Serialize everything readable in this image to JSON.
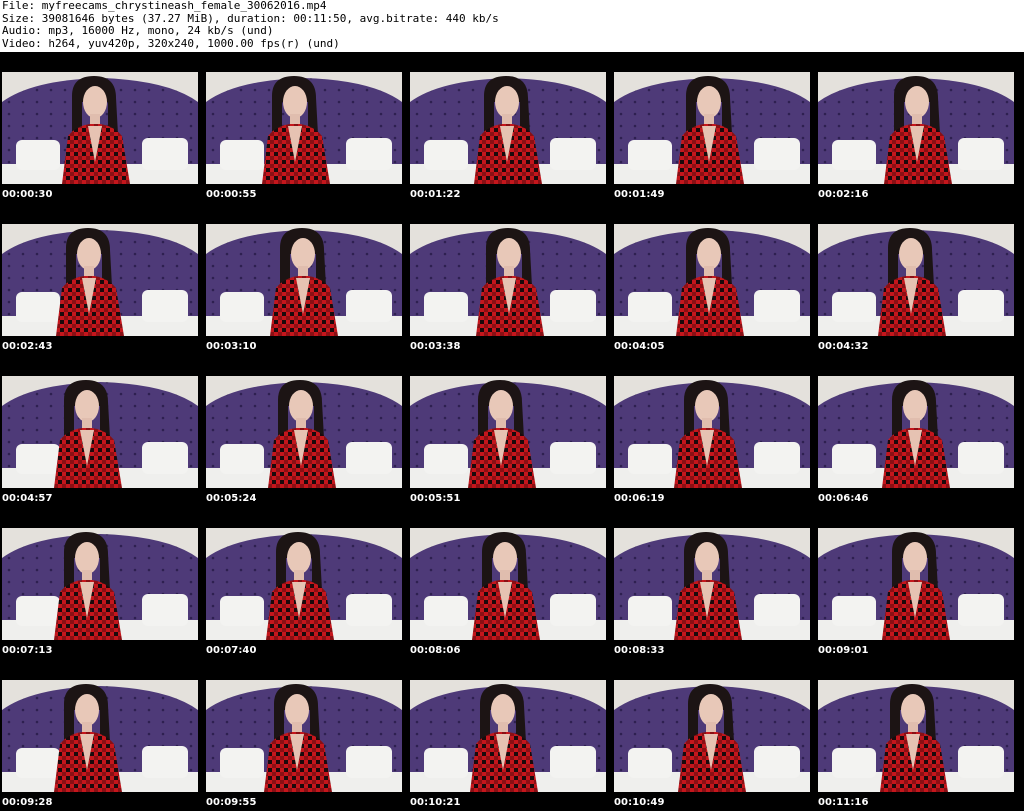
{
  "header": {
    "file": "File: myfreecams_chrystineash_female_30062016.mp4",
    "size": "Size: 39081646 bytes (37.27 MiB), duration: 00:11:50, avg.bitrate: 440 kb/s",
    "audio": "Audio: mp3, 16000 Hz, mono, 24 kb/s (und)",
    "video": "Video: h264, yuv420p, 320x240, 1000.00 fps(r) (und)"
  },
  "colors": {
    "background": "#000000",
    "headboard": "#4e3a78",
    "shirt_red": "#c4161c",
    "wall": "#e4e1dc",
    "pillow": "#f3f3f1"
  },
  "thumbnails": [
    {
      "time": "00:00:30"
    },
    {
      "time": "00:00:55"
    },
    {
      "time": "00:01:22"
    },
    {
      "time": "00:01:49"
    },
    {
      "time": "00:02:16"
    },
    {
      "time": "00:02:43"
    },
    {
      "time": "00:03:10"
    },
    {
      "time": "00:03:38"
    },
    {
      "time": "00:04:05"
    },
    {
      "time": "00:04:32"
    },
    {
      "time": "00:04:57"
    },
    {
      "time": "00:05:24"
    },
    {
      "time": "00:05:51"
    },
    {
      "time": "00:06:19"
    },
    {
      "time": "00:06:46"
    },
    {
      "time": "00:07:13"
    },
    {
      "time": "00:07:40"
    },
    {
      "time": "00:08:06"
    },
    {
      "time": "00:08:33"
    },
    {
      "time": "00:09:01"
    },
    {
      "time": "00:09:28"
    },
    {
      "time": "00:09:55"
    },
    {
      "time": "00:10:21"
    },
    {
      "time": "00:10:49"
    },
    {
      "time": "00:11:16"
    }
  ]
}
